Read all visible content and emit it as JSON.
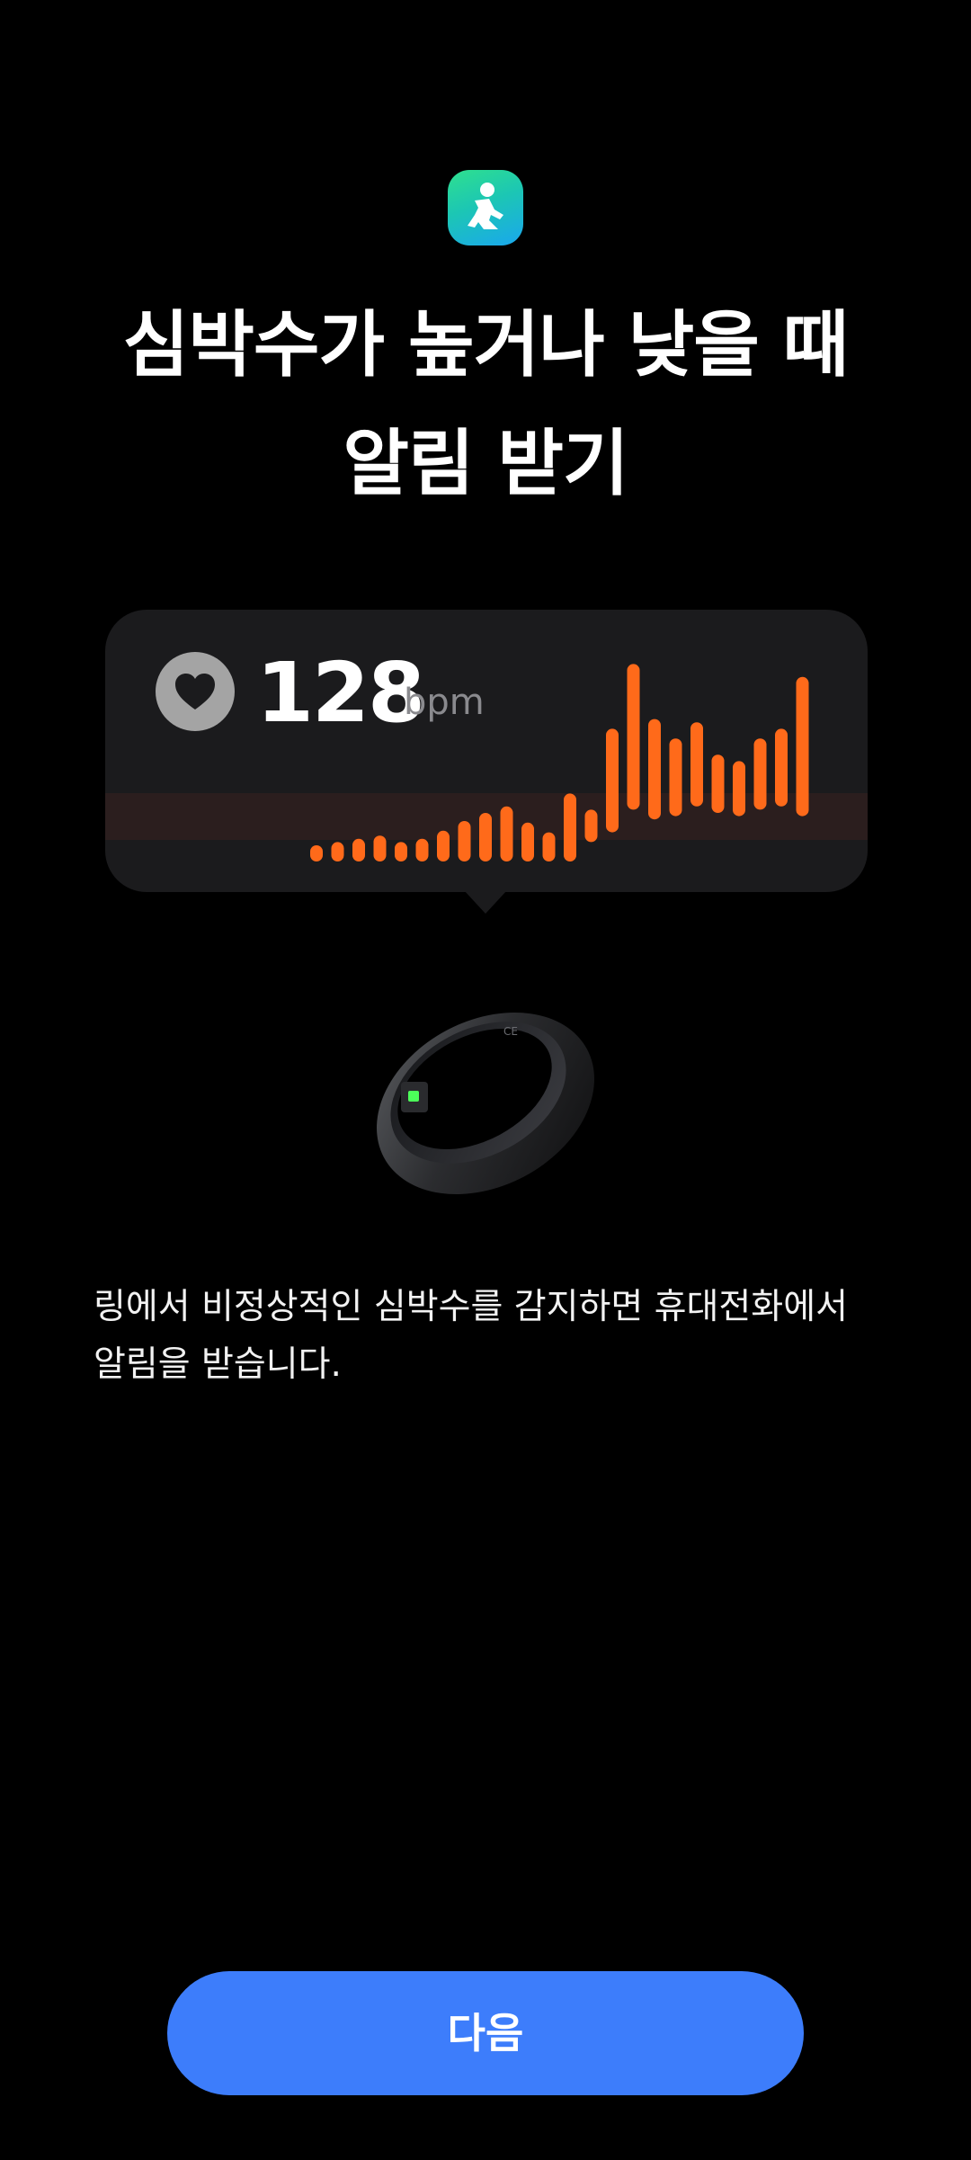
{
  "app": {
    "icon": "samsung-health-icon",
    "icon_colors": [
      "#2fe08e",
      "#1aa7ee"
    ]
  },
  "title": {
    "line1": "심박수가 높거나 낮을 때",
    "line2": "알림 받기"
  },
  "heart_rate_card": {
    "icon": "heart-icon",
    "value": "128",
    "unit": "bpm",
    "bar_color": "#ff6a1a",
    "bar_levels": [
      0.1,
      0.12,
      0.14,
      0.16,
      0.12,
      0.14,
      0.19,
      0.25,
      0.3,
      0.34,
      0.24,
      0.18,
      0.42,
      0.2,
      0.64,
      0.9,
      0.62,
      0.48,
      0.52,
      0.36,
      0.34,
      0.44,
      0.48,
      0.86
    ],
    "bar_offsets": [
      0,
      0,
      0,
      0,
      0,
      0,
      0,
      0,
      0,
      0,
      0,
      0,
      0,
      0.12,
      0.18,
      0.32,
      0.26,
      0.28,
      0.34,
      0.3,
      0.28,
      0.32,
      0.34,
      0.28
    ]
  },
  "description": "링에서 비정상적인 심박수를 감지하면 휴대전화에서 알림을 받습니다.",
  "buttons": {
    "next_label": "다음"
  },
  "colors": {
    "background": "#000000",
    "card": "#1b1b1d",
    "accent": "#3d7dfb",
    "bar": "#ff6a1a"
  }
}
